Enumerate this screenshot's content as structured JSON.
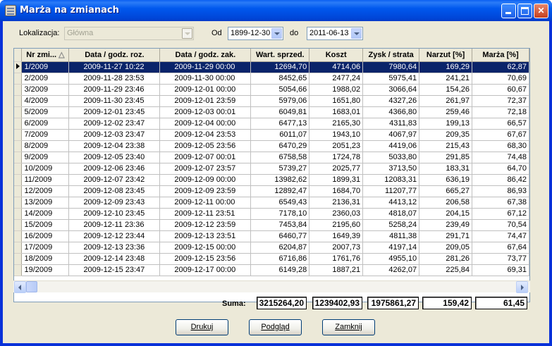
{
  "window": {
    "title": "Marża na zmianach"
  },
  "filters": {
    "location_label": "Lokalizacja:",
    "location_value": "Główna",
    "from_label": "Od",
    "from_value": "1899-12-30",
    "to_label": "do",
    "to_value": "2011-06-13"
  },
  "table": {
    "columns": [
      "Nr zmi...",
      "Data / godz. roz.",
      "Data / godz. zak.",
      "Wart. sprzed.",
      "Koszt",
      "Zysk / strata",
      "Narzut [%]",
      "Marża [%]"
    ],
    "rows": [
      [
        "1/2009",
        "2009-11-27  10:22",
        "2009-11-29  00:00",
        "12694,70",
        "4714,06",
        "7980,64",
        "169,29",
        "62,87"
      ],
      [
        "2/2009",
        "2009-11-28  23:53",
        "2009-11-30  00:00",
        "8452,65",
        "2477,24",
        "5975,41",
        "241,21",
        "70,69"
      ],
      [
        "3/2009",
        "2009-11-29  23:46",
        "2009-12-01  00:00",
        "5054,66",
        "1988,02",
        "3066,64",
        "154,26",
        "60,67"
      ],
      [
        "4/2009",
        "2009-11-30  23:45",
        "2009-12-01  23:59",
        "5979,06",
        "1651,80",
        "4327,26",
        "261,97",
        "72,37"
      ],
      [
        "5/2009",
        "2009-12-01  23:45",
        "2009-12-03  00:01",
        "6049,81",
        "1683,01",
        "4366,80",
        "259,46",
        "72,18"
      ],
      [
        "6/2009",
        "2009-12-02  23:47",
        "2009-12-04  00:00",
        "6477,13",
        "2165,30",
        "4311,83",
        "199,13",
        "66,57"
      ],
      [
        "7/2009",
        "2009-12-03  23:47",
        "2009-12-04  23:53",
        "6011,07",
        "1943,10",
        "4067,97",
        "209,35",
        "67,67"
      ],
      [
        "8/2009",
        "2009-12-04  23:38",
        "2009-12-05  23:56",
        "6470,29",
        "2051,23",
        "4419,06",
        "215,43",
        "68,30"
      ],
      [
        "9/2009",
        "2009-12-05  23:40",
        "2009-12-07  00:01",
        "6758,58",
        "1724,78",
        "5033,80",
        "291,85",
        "74,48"
      ],
      [
        "10/2009",
        "2009-12-06  23:46",
        "2009-12-07  23:57",
        "5739,27",
        "2025,77",
        "3713,50",
        "183,31",
        "64,70"
      ],
      [
        "11/2009",
        "2009-12-07  23:42",
        "2009-12-09  00:00",
        "13982,62",
        "1899,31",
        "12083,31",
        "636,19",
        "86,42"
      ],
      [
        "12/2009",
        "2009-12-08  23:45",
        "2009-12-09  23:59",
        "12892,47",
        "1684,70",
        "11207,77",
        "665,27",
        "86,93"
      ],
      [
        "13/2009",
        "2009-12-09  23:43",
        "2009-12-11  00:00",
        "6549,43",
        "2136,31",
        "4413,12",
        "206,58",
        "67,38"
      ],
      [
        "14/2009",
        "2009-12-10  23:45",
        "2009-12-11  23:51",
        "7178,10",
        "2360,03",
        "4818,07",
        "204,15",
        "67,12"
      ],
      [
        "15/2009",
        "2009-12-11  23:36",
        "2009-12-12  23:59",
        "7453,84",
        "2195,60",
        "5258,24",
        "239,49",
        "70,54"
      ],
      [
        "16/2009",
        "2009-12-12  23:44",
        "2009-12-13  23:51",
        "6460,77",
        "1649,39",
        "4811,38",
        "291,71",
        "74,47"
      ],
      [
        "17/2009",
        "2009-12-13  23:36",
        "2009-12-15  00:00",
        "6204,87",
        "2007,73",
        "4197,14",
        "209,05",
        "67,64"
      ],
      [
        "18/2009",
        "2009-12-14  23:48",
        "2009-12-15  23:56",
        "6716,86",
        "1761,76",
        "4955,10",
        "281,26",
        "73,77"
      ],
      [
        "19/2009",
        "2009-12-15  23:47",
        "2009-12-17  00:00",
        "6149,28",
        "1887,21",
        "4262,07",
        "225,84",
        "69,31"
      ]
    ]
  },
  "totals": {
    "label": "Suma:",
    "sales": "3215264,20",
    "cost": "1239402,93",
    "profit": "1975861,27",
    "markup": "159,42",
    "margin": "61,45"
  },
  "buttons": {
    "print": "Drukuj",
    "preview": "Podgląd",
    "close": "Zamknij"
  },
  "colors": {
    "title_bar": "#0058ee",
    "selection": "#0a246a",
    "face": "#ece9d8"
  }
}
